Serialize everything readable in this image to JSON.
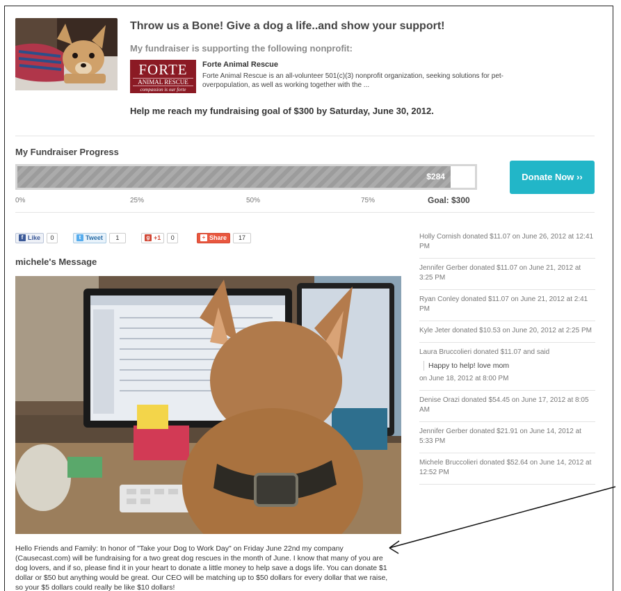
{
  "header": {
    "title": "Throw us a Bone! Give a dog a life..and show your support!",
    "subtitle": "My fundraiser is supporting the following nonprofit:",
    "nonprofit": {
      "logo_line1": "FORTE",
      "logo_line2": "ANIMAL RESCUE",
      "logo_line3": "compassion is our forte",
      "name": "Forte Animal Rescue",
      "description": "Forte Animal Rescue is an all-volunteer 501(c)(3) nonprofit organization, seeking solutions for pet-overpopulation, as well as working together with the ..."
    },
    "goal_text": "Help me reach my fundraising goal of $300 by Saturday, June 30, 2012."
  },
  "progress": {
    "title": "My Fundraiser Progress",
    "raised_label": "$284",
    "raised_fraction": 0.9467,
    "ticks": [
      "0%",
      "25%",
      "50%",
      "75%"
    ],
    "goal_label": "Goal: $300",
    "donate_button": "Donate Now ››"
  },
  "social": {
    "like_label": "Like",
    "like_count": "0",
    "tweet_label": "Tweet",
    "tweet_count": "1",
    "gplus_label": "+1",
    "gplus_count": "0",
    "share_label": "Share",
    "share_count": "17"
  },
  "message": {
    "title": "michele's Message",
    "body": "Hello Friends and Family: In honor of \"Take your Dog to Work Day\" on Friday June 22nd my company (Causecast.com) will be fundraising for a two great dog rescues in the month of June. I know that many of you are dog lovers, and if so, please find it in your heart to donate a little money to help save a dogs life. You can donate $1 dollar or $50 but anything would be great. Our CEO will be matching up to $50 dollars for every dollar that we raise, so your $5 dollars could really be like $10 dollars!"
  },
  "donations": [
    {
      "text": "Holly Cornish donated $11.07 on June 26, 2012 at 12:41 PM"
    },
    {
      "text": "Jennifer Gerber donated $11.07 on June 21, 2012 at 3:25 PM"
    },
    {
      "text": "Ryan Conley donated $11.07 on June 21, 2012 at 2:41 PM"
    },
    {
      "text": "Kyle Jeter donated $10.53 on June 20, 2012 at 2:25 PM"
    },
    {
      "text": "Laura Bruccolieri donated $11.07 and said",
      "quote": "Happy to help! love mom",
      "after": "on June 18, 2012 at 8:00 PM"
    },
    {
      "text": "Denise Orazi donated $54.45 on June 17, 2012 at 8:05 AM"
    },
    {
      "text": "Jennifer Gerber donated $21.91 on June 14, 2012 at 5:33 PM"
    },
    {
      "text": "Michele Bruccolieri donated $52.64 on June 14, 2012 at 12:52 PM"
    }
  ],
  "colors": {
    "donate_button": "#22b6c8",
    "logo_bg": "#8b1a24",
    "bar_stripe": "#9c9c9c"
  }
}
